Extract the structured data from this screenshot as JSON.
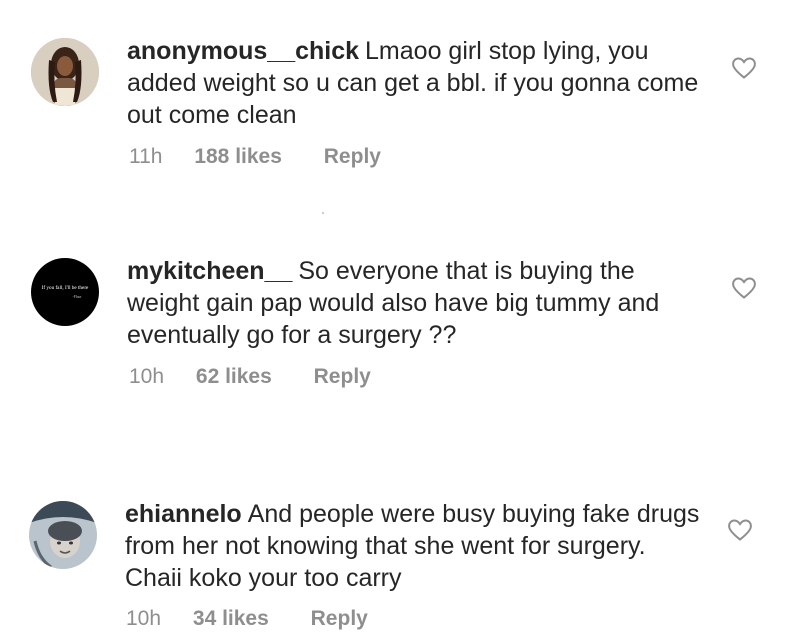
{
  "comments": [
    {
      "username": "anonymous__chick",
      "text": "Lmaoo girl stop lying, you added weight so u can get a bbl. if you gonna come out come clean",
      "time": "11h",
      "likes": "188 likes",
      "reply": "Reply",
      "avatar_icon": "user-photo-avatar",
      "heart_icon": "heart-outline-icon"
    },
    {
      "username": "mykitcheen__",
      "text": "So everyone that is buying the weight gain pap would also have big tummy and eventually go for a surgery ??",
      "time": "10h",
      "likes": "62 likes",
      "reply": "Reply",
      "avatar_text_1": "If you fall, I'll be there",
      "avatar_text_2": "-Floor",
      "avatar_icon": "quote-avatar",
      "heart_icon": "heart-outline-icon"
    },
    {
      "username": "ehiannelo",
      "text": "And people were busy buying fake drugs from her not knowing that she went for surgery. Chaii koko your too carry",
      "time": "10h",
      "likes": "34 likes",
      "reply": "Reply",
      "avatar_icon": "user-photo-avatar",
      "heart_icon": "heart-outline-icon"
    }
  ],
  "colors": {
    "text": "#262626",
    "meta": "#8e8e8e",
    "background": "#ffffff"
  }
}
